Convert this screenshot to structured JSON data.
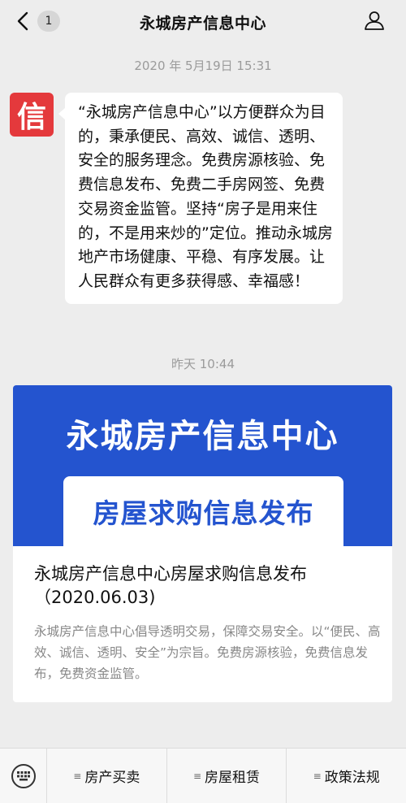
{
  "header": {
    "badge_count": "1",
    "title": "永城房产信息中心"
  },
  "chat": {
    "timestamp_1": "2020 年 5月19日 15:31",
    "avatar_char": "信",
    "message": "“永城房产信息中心”以方便群众为目的，秉承便民、高效、诚信、透明、安全的服务理念。免费房源核验、免费信息发布、免费二手房网签、免费交易资金监管。坚持“房子是用来住的，不是用来炒的”定位。推动永城房地产市场健康、平稳、有序发展。让人民群众有更多获得感、幸福感！",
    "timestamp_2": "昨天 10:44"
  },
  "article": {
    "banner_title": "永城房产信息中心",
    "banner_subtitle": "房屋求购信息发布",
    "title": "永城房产信息中心房屋求购信息发布（2020.06.03)",
    "description": "永城房产信息中心倡导透明交易，保障交易安全。以“便民、高效、诚信、透明、安全”为宗旨。免费房源核验，免费信息发布，免费资金监管。"
  },
  "bottom_menu": {
    "keyboard_icon": "keyboard-icon",
    "items": [
      {
        "label": "房产买卖"
      },
      {
        "label": "房屋租赁"
      },
      {
        "label": "政策法规"
      }
    ]
  },
  "colors": {
    "background": "#ededed",
    "brand_red": "#e4393c",
    "banner_blue": "#2454cf"
  }
}
